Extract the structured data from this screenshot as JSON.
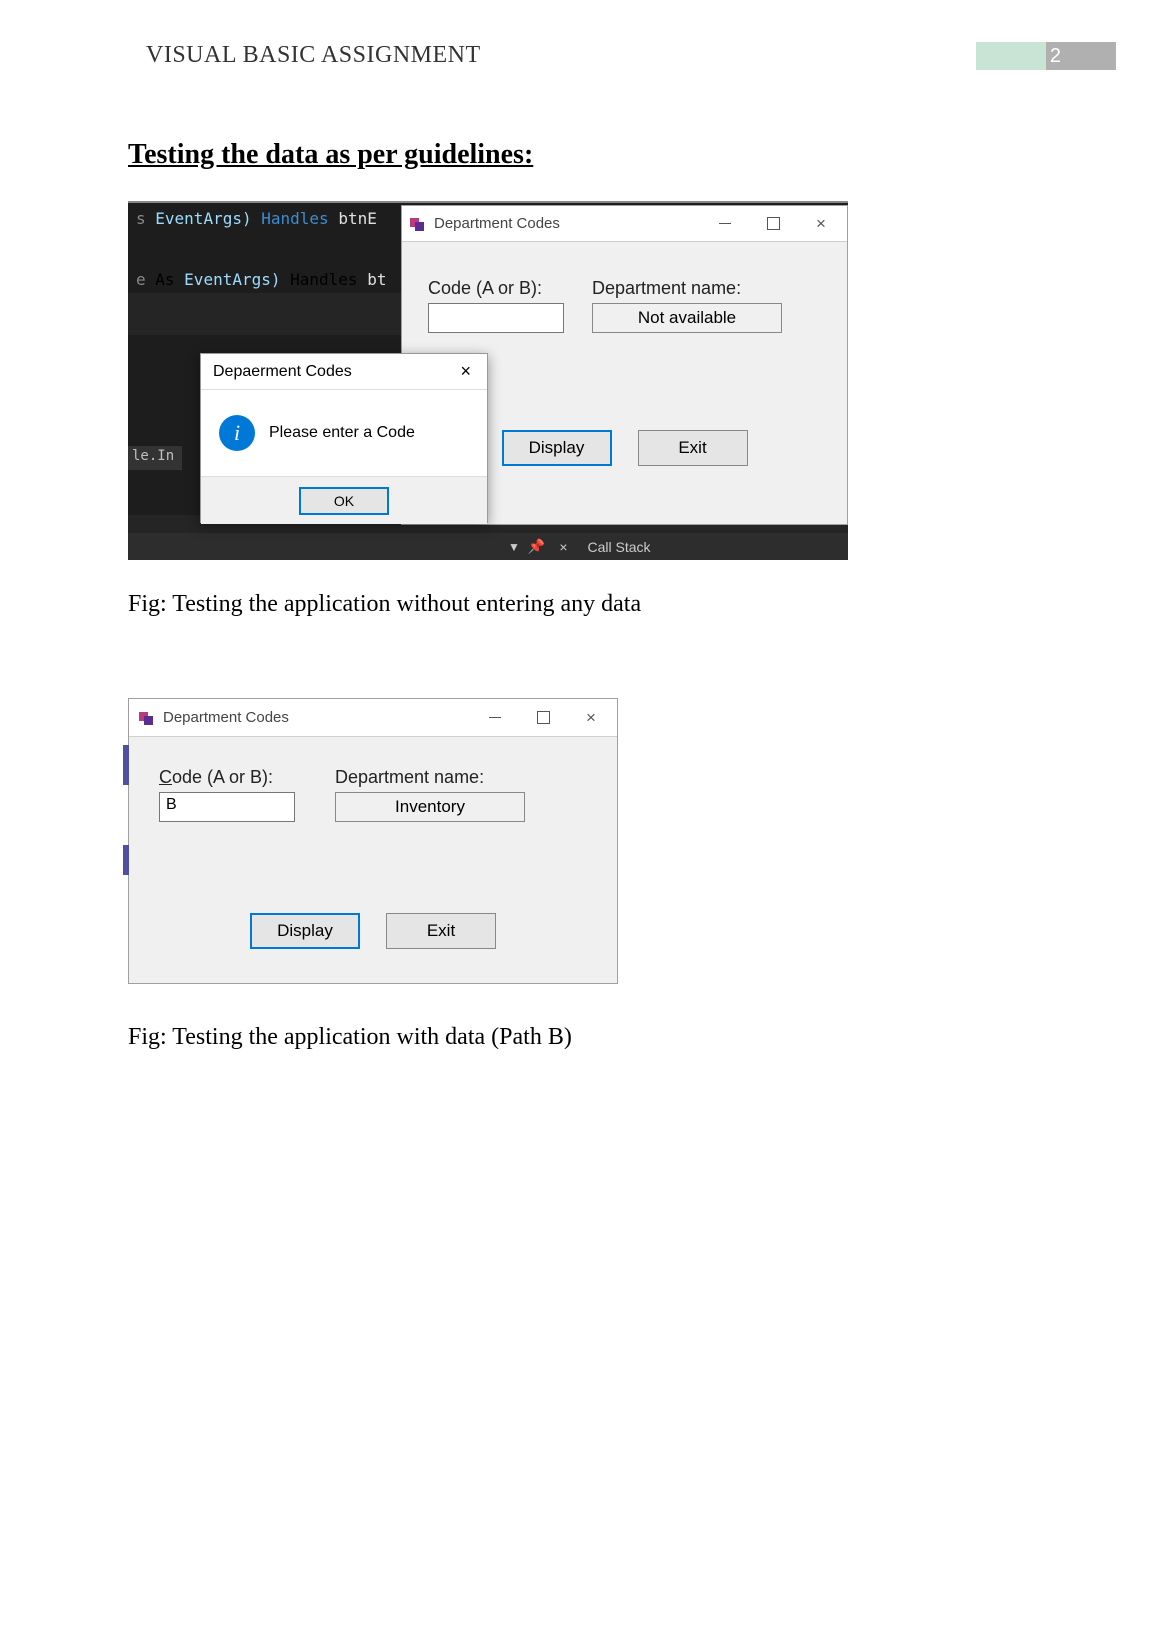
{
  "header": {
    "title": "VISUAL BASIC ASSIGNMENT",
    "page_number": "2"
  },
  "section_heading": "Testing the data as per guidelines:",
  "screenshot1": {
    "code_top": {
      "prefix_s": "s",
      "eventargs": " EventArgs)",
      "handles": " Handles ",
      "btn": "btnE"
    },
    "code_mid": {
      "prefix_e": "e",
      "as": " As ",
      "eventargs": "EventArgs)",
      "handles": " Handles ",
      "bt": "bt"
    },
    "left_strip": "le.In",
    "window": {
      "title": "Department Codes",
      "code_label": "Code (A or B):",
      "code_value": "",
      "dept_label": "Department name:",
      "dept_value": "Not available",
      "display_btn": "Display",
      "exit_btn": "Exit"
    },
    "msgbox": {
      "title": "Depaerment Codes",
      "text": "Please enter a Code",
      "ok": "OK"
    },
    "bottom_bar": {
      "pin": "📌",
      "x": "×",
      "stack": "Call Stack"
    }
  },
  "caption1": "Fig: Testing the application without entering any data",
  "screenshot2": {
    "title": "Department Codes",
    "code_label_pre": "C",
    "code_label_post": "ode (A or B):",
    "code_value": "B",
    "dept_label": "Department name:",
    "dept_value": "Inventory",
    "display_pre": "D",
    "display_post": "isplay",
    "exit_pre": "E",
    "exit_mid": "x",
    "exit_post": "it"
  },
  "caption2": "Fig: Testing the application with data (Path B)"
}
